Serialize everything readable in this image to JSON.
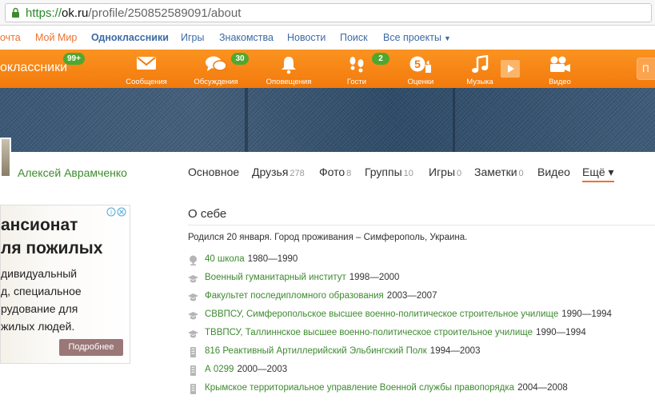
{
  "browser": {
    "url_protocol": "https://",
    "url_host": "ok.ru",
    "url_path": "/profile/250852589091/about"
  },
  "top_links": {
    "items": [
      "очта",
      "Мой Мир",
      "Одноклассники",
      "Игры",
      "Знакомства",
      "Новости",
      "Поиск",
      "Все проекты"
    ]
  },
  "nav": {
    "logo": "оклассники",
    "logo_badge": "99+",
    "items": [
      {
        "label": "Сообщения",
        "icon": "envelope-icon",
        "badge": ""
      },
      {
        "label": "Обсуждения",
        "icon": "chat-bubbles-icon",
        "badge": "30"
      },
      {
        "label": "Оповещения",
        "icon": "bell-icon",
        "badge": ""
      },
      {
        "label": "Гости",
        "icon": "footprints-icon",
        "badge": "2"
      },
      {
        "label": "Оценки",
        "icon": "rating-five-icon",
        "badge": ""
      },
      {
        "label": "Музыка",
        "icon": "music-note-icon",
        "badge": ""
      },
      {
        "label": "Видео",
        "icon": "video-camera-icon",
        "badge": ""
      }
    ],
    "right_button": "П"
  },
  "profile": {
    "name": "Алексей Аврамченко",
    "tabs": [
      {
        "label": "Основное",
        "count": ""
      },
      {
        "label": "Друзья",
        "count": "278"
      },
      {
        "label": "Фото",
        "count": "8"
      },
      {
        "label": "Группы",
        "count": "10"
      },
      {
        "label": "Игры",
        "count": "0"
      },
      {
        "label": "Заметки",
        "count": "0"
      },
      {
        "label": "Видео",
        "count": ""
      },
      {
        "label": "Ещё ▾",
        "count": ""
      }
    ]
  },
  "ad": {
    "title_line1": "ансионат",
    "title_line2": "ля пожилых",
    "text_line1": "дивидуальный",
    "text_line2": "д, специальное",
    "text_line3": "рудование для",
    "text_line4": "жилых людей.",
    "button": "Подробнее",
    "info_icon": "info-close-icon"
  },
  "about": {
    "title": "О себе",
    "born": "Родился 20 января. Город проживания – Симферополь, Украина.",
    "entries": [
      {
        "icon": "school-icon",
        "name": "40 школа",
        "years": "1980—1990"
      },
      {
        "icon": "graduation-cap-icon",
        "name": "Военный гуманитарный институт",
        "years": "1998—2000"
      },
      {
        "icon": "graduation-cap-icon",
        "name": "Факультет последипломного образования",
        "years": "2003—2007"
      },
      {
        "icon": "graduation-cap-icon",
        "name": "СВВПСУ, Симферопольское высшее военно-политическое строительное училище",
        "years": "1990—1994"
      },
      {
        "icon": "graduation-cap-icon",
        "name": "ТВВПСУ, Таллиннское высшее военно-политическое строительное училище",
        "years": "1990—1994"
      },
      {
        "icon": "army-icon",
        "name": "816 Реактивный Артиллерийский Эльбингский Полк",
        "years": "1994—2003"
      },
      {
        "icon": "army-icon",
        "name": "А 0299",
        "years": "2000—2003"
      },
      {
        "icon": "army-icon",
        "name": "Крымское территориальное управление Военной службы правопорядка",
        "years": "2004—2008"
      }
    ]
  }
}
